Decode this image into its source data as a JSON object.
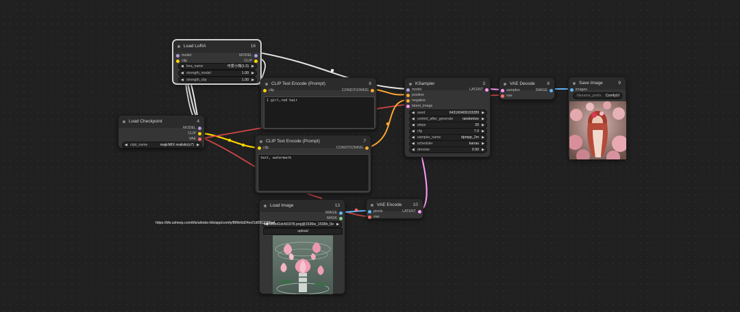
{
  "colors": {
    "model": "#b39ddb",
    "clip": "#ffd500",
    "vae": "#ff6e6e",
    "conditioning": "#ffa931",
    "latent": "#ff9cf9",
    "image": "#64b5f6"
  },
  "nodes": {
    "load_lora": {
      "title": "Load LoRA",
      "id": "16",
      "inputs": [
        "model",
        "clip"
      ],
      "outputs": [
        "MODEL",
        "CLIP"
      ],
      "widgets": [
        {
          "label": "lora_name",
          "value": "可爱小熊(1.0)"
        },
        {
          "label": "strength_model",
          "value": "1.00"
        },
        {
          "label": "strength_clip",
          "value": "1.00"
        }
      ]
    },
    "load_checkpoint": {
      "title": "Load Checkpoint",
      "id": "4",
      "outputs": [
        "MODEL",
        "CLIP",
        "VAE"
      ],
      "widgets": [
        {
          "label": "ckpt_name",
          "value": "majicMIX realistic(v7)"
        }
      ]
    },
    "clip_pos": {
      "title": "CLIP Text Encode (Prompt)",
      "id": "6",
      "input": "clip",
      "output": "CONDITIONING",
      "text": "1 girl,red hair"
    },
    "clip_neg": {
      "title": "CLIP Text Encode (Prompt)",
      "id": "7",
      "input": "clip",
      "output": "CONDITIONING",
      "text": "text, watermark"
    },
    "ksampler": {
      "title": "KSampler",
      "id": "3",
      "inputs": [
        "model",
        "positive",
        "negative",
        "latent_image"
      ],
      "output": "LATENT",
      "widgets": [
        {
          "label": "seed",
          "value": "643160409103289"
        },
        {
          "label": "control_after_generate",
          "value": "randomize"
        },
        {
          "label": "steps",
          "value": "20"
        },
        {
          "label": "cfg",
          "value": "7.0"
        },
        {
          "label": "sampler_name",
          "value": "dpmpp_2m"
        },
        {
          "label": "scheduler",
          "value": "karras"
        },
        {
          "label": "denoise",
          "value": "0.50"
        }
      ]
    },
    "vae_decode": {
      "title": "VAE Decode",
      "id": "8",
      "inputs": [
        "samples",
        "vae"
      ],
      "output": "IMAGE"
    },
    "save_image": {
      "title": "Save Image",
      "id": "9",
      "input": "images",
      "widget": {
        "label": "filename_prefix",
        "value": "ComfyUI"
      }
    },
    "load_image": {
      "title": "Load Image",
      "id": "13",
      "outputs": [
        "IMAGE",
        "MASK"
      ],
      "widget_value": "4fb9d98ed1dcfd1978.png@1536w_1536h_0e",
      "url_text": "https://bfs.ssheep.com/bfs/aihobo-bfs/app/comfy/f86fe6d24ecf1d0912386a4",
      "upload_label": "upload"
    },
    "vae_encode": {
      "title": "VAE Encode",
      "id": "10",
      "inputs": [
        "pixels",
        "vae"
      ],
      "output": "LATENT"
    }
  }
}
